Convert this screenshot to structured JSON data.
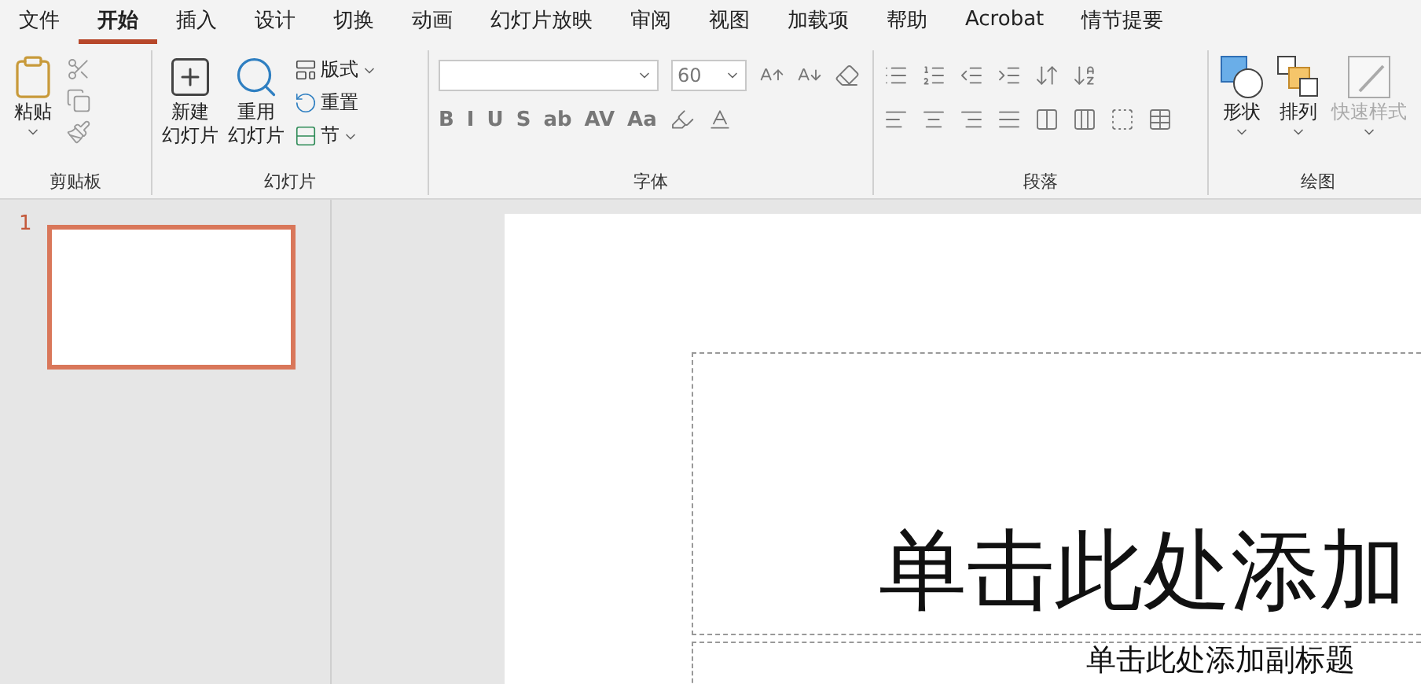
{
  "tabs": [
    {
      "label": "文件",
      "selected": false
    },
    {
      "label": "开始",
      "selected": true
    },
    {
      "label": "插入",
      "selected": false
    },
    {
      "label": "设计",
      "selected": false
    },
    {
      "label": "切换",
      "selected": false
    },
    {
      "label": "动画",
      "selected": false
    },
    {
      "label": "幻灯片放映",
      "selected": false
    },
    {
      "label": "审阅",
      "selected": false
    },
    {
      "label": "视图",
      "selected": false
    },
    {
      "label": "加载项",
      "selected": false
    },
    {
      "label": "帮助",
      "selected": false
    },
    {
      "label": "Acrobat",
      "selected": false
    },
    {
      "label": "情节提要",
      "selected": false
    }
  ],
  "clipboard": {
    "paste": "粘贴",
    "label": "剪贴板"
  },
  "slides_group": {
    "new_slide": [
      "新建",
      "幻灯片"
    ],
    "reuse": [
      "重用",
      "幻灯片"
    ],
    "layout": "版式",
    "reset": "重置",
    "section": "节",
    "label": "幻灯片"
  },
  "font_group": {
    "font_size": "60",
    "buttons": [
      "B",
      "I",
      "U",
      "S",
      "ab",
      "AV",
      "Aa"
    ],
    "label": "字体"
  },
  "paragraph_group": {
    "label": "段落"
  },
  "drawing_group": {
    "items": [
      {
        "label": "形状",
        "disabled": false
      },
      {
        "label": "排列",
        "disabled": false
      },
      {
        "label": "快速样式",
        "disabled": true
      }
    ],
    "label": "绘图"
  },
  "thumbnails": [
    {
      "number": "1",
      "selected": true
    }
  ],
  "slide": {
    "title": "单击此处添加",
    "subtitle": "单击此处添加副标题"
  }
}
